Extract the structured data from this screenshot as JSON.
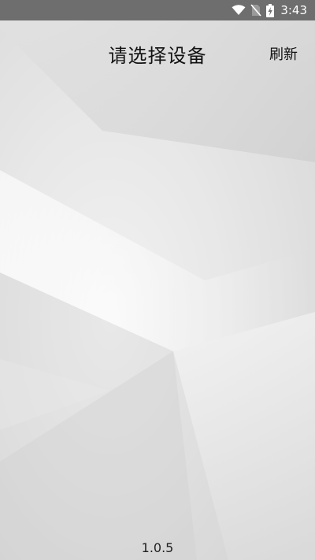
{
  "status_bar": {
    "time": "3:43",
    "icons": [
      "wifi-icon",
      "no-sim-icon",
      "battery-charging-icon"
    ]
  },
  "header": {
    "title": "请选择设备",
    "refresh_label": "刷新"
  },
  "footer": {
    "version": "1.0.5"
  },
  "colors": {
    "status_bar_bg": "#6e6e6e",
    "text": "#111111"
  }
}
